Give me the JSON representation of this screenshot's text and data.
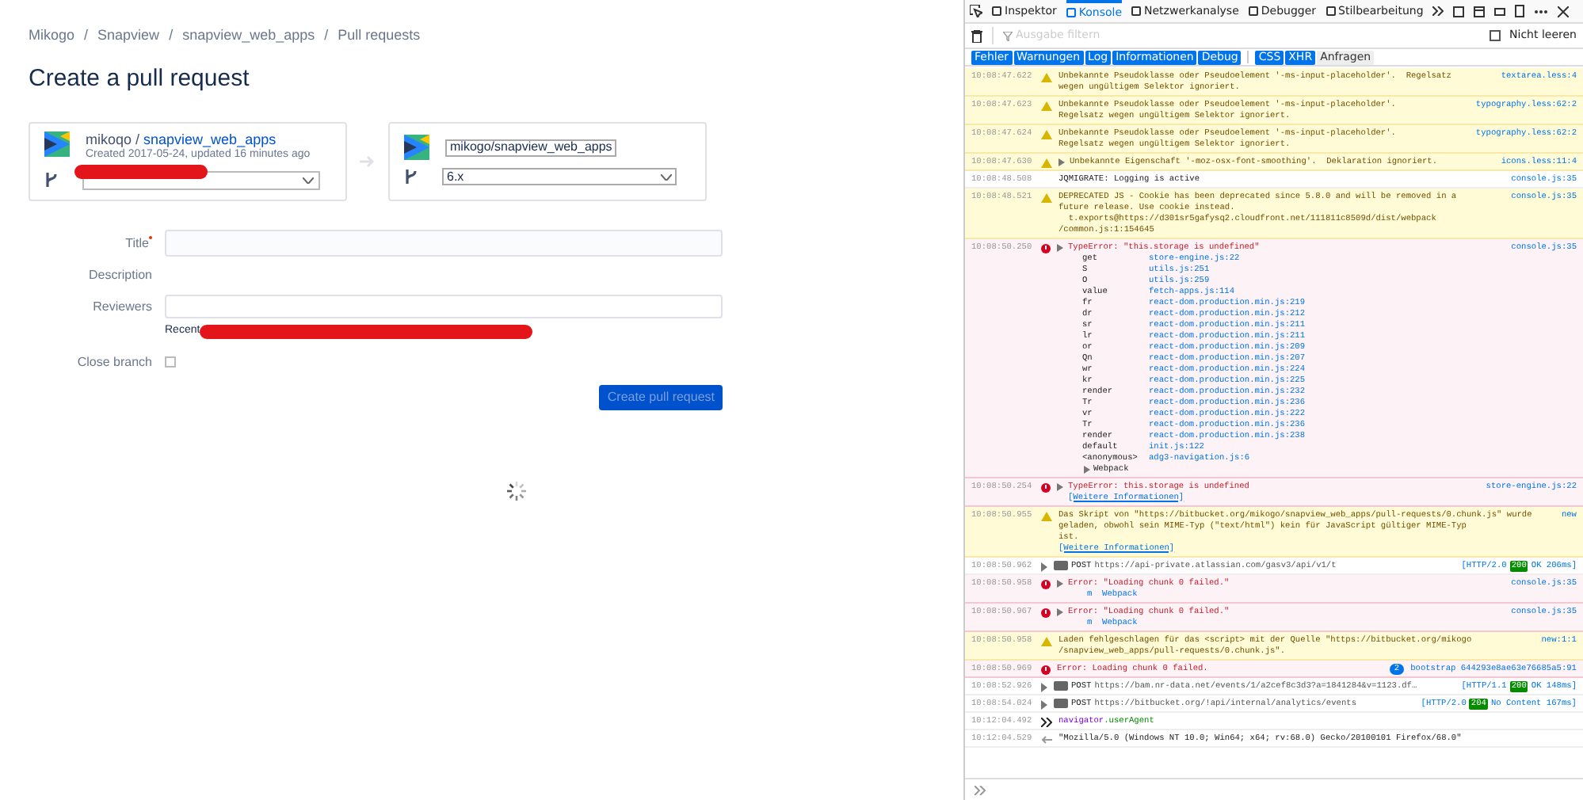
{
  "breadcrumbs": [
    "Mikogo",
    "Snapview",
    "snapview_web_apps",
    "Pull requests"
  ],
  "breadcrumb_separators": [
    "/",
    "/",
    "/"
  ],
  "page_title": "Create a pull request",
  "source": {
    "owner": "mikoqo /",
    "repo": "snapview_web_apps",
    "meta": "Created 2017-05-24, updated 16 minutes ago"
  },
  "destination": {
    "repo_select": "mikogo/snapview_web_apps",
    "branch_select": "6.x"
  },
  "form": {
    "title_label": "Title",
    "description_label": "Description",
    "reviewers_label": "Reviewers",
    "recent_label": "Recent",
    "close_branch_label": "Close branch",
    "close_branch_checked": false,
    "submit": "Create pull request",
    "submit_disabled": true
  },
  "devtools": {
    "tabs": [
      {
        "label": "Inspektor",
        "selected": false
      },
      {
        "label": "Konsole",
        "selected": true
      },
      {
        "label": "Netzwerkanalyse",
        "selected": false
      },
      {
        "label": "Debugger",
        "selected": false
      },
      {
        "label": "Stilbearbeitung",
        "selected": false
      }
    ],
    "filter_placeholder": "Ausgabe filtern",
    "persist_label": "Nicht leeren",
    "persist_checked": false,
    "filters": [
      {
        "label": "Fehler",
        "selected": true
      },
      {
        "label": "Warnungen",
        "selected": true
      },
      {
        "label": "Log",
        "selected": true
      },
      {
        "label": "Informationen",
        "selected": true
      },
      {
        "label": "Debug",
        "selected": true
      },
      {
        "label": "CSS",
        "selected": true
      },
      {
        "label": "XHR",
        "selected": true
      },
      {
        "label": "Anfragen",
        "selected": false
      }
    ],
    "entries": [
      {
        "kind": "warn",
        "time": "10:08:47.622",
        "lines": [
          "Unbekannte Pseudoklasse oder Pseudoelement '-ms-input-placeholder'.  Regelsatz",
          "wegen ungültigem Selektor ignoriert."
        ],
        "source": "textarea.less:4"
      },
      {
        "kind": "warn",
        "time": "10:08:47.623",
        "lines": [
          "Unbekannte Pseudoklasse oder Pseudoelement '-ms-input-placeholder'.",
          "Regelsatz wegen ungültigem Selektor ignoriert."
        ],
        "source": "typography.less:62:2"
      },
      {
        "kind": "warn",
        "time": "10:08:47.624",
        "lines": [
          "Unbekannte Pseudoklasse oder Pseudoelement '-ms-input-placeholder'.",
          "Regelsatz wegen ungültigem Selektor ignoriert."
        ],
        "source": "typography.less:62:2"
      },
      {
        "kind": "warn",
        "time": "10:08:47.630",
        "expandable": true,
        "lines": [
          "Unbekannte Eigenschaft '-moz-osx-font-smoothing'.  Deklaration ignoriert."
        ],
        "source": "icons.less:11:4"
      },
      {
        "kind": "log",
        "time": "10:08:48.508",
        "lines": [
          "JQMIGRATE: Logging is active"
        ],
        "source": "console.js:35"
      },
      {
        "kind": "warn",
        "time": "10:08:48.521",
        "lines": [
          "DEPRECATED JS - Cookie has been deprecated since 5.8.0 and will be removed in a",
          "future release. Use cookie instead.",
          "  t.exports@https://d301sr5gafysq2.cloudfront.net/111811c8509d/dist/webpack",
          "/common.js:1:154645"
        ],
        "source": "console.js:35"
      },
      {
        "kind": "error",
        "time": "10:08:50.250",
        "expandable": true,
        "lines": [
          "TypeError: \"this.storage is undefined\""
        ],
        "source": "console.js:35",
        "stack": [
          {
            "fn": "get",
            "loc": "store-engine.js:22"
          },
          {
            "fn": "S",
            "loc": "utils.js:251"
          },
          {
            "fn": "O",
            "loc": "utils.js:259"
          },
          {
            "fn": "value",
            "loc": "fetch-apps.js:114"
          },
          {
            "fn": "fr",
            "loc": "react-dom.production.min.js:219"
          },
          {
            "fn": "dr",
            "loc": "react-dom.production.min.js:212"
          },
          {
            "fn": "sr",
            "loc": "react-dom.production.min.js:211"
          },
          {
            "fn": "lr",
            "loc": "react-dom.production.min.js:211"
          },
          {
            "fn": "or",
            "loc": "react-dom.production.min.js:209"
          },
          {
            "fn": "Qn",
            "loc": "react-dom.production.min.js:207"
          },
          {
            "fn": "wr",
            "loc": "react-dom.production.min.js:224"
          },
          {
            "fn": "kr",
            "loc": "react-dom.production.min.js:225"
          },
          {
            "fn": "render",
            "loc": "react-dom.production.min.js:232"
          },
          {
            "fn": "Tr",
            "loc": "react-dom.production.min.js:236"
          },
          {
            "fn": "vr",
            "loc": "react-dom.production.min.js:222"
          },
          {
            "fn": "Tr",
            "loc": "react-dom.production.min.js:236"
          },
          {
            "fn": "render",
            "loc": "react-dom.production.min.js:238"
          },
          {
            "fn": "default",
            "loc": "init.js:122"
          },
          {
            "fn": "<anonymous>",
            "loc": "adg3-navigation.js:6"
          }
        ],
        "footer": "Webpack"
      },
      {
        "kind": "error",
        "time": "10:08:50.254",
        "expandable": true,
        "lines": [
          "TypeError: this.storage is undefined"
        ],
        "link": "[Weitere Informationen]",
        "source": "store-engine.js:22"
      },
      {
        "kind": "warn",
        "time": "10:08:50.955",
        "lines": [
          "Das Skript von \"https://bitbucket.org/mikogo/snapview_web_apps/pull-requests/0.chunk.js\" wurde",
          "geladen, obwohl sein MIME-Typ (\"text/html\") kein für JavaScript gültiger MIME-Typ",
          "ist."
        ],
        "link": "[Weitere Informationen]",
        "source": "new"
      },
      {
        "kind": "net",
        "time": "10:08:50.962",
        "method": "POST",
        "url": "https://api-private.atlassian.com/gasv3/api/v1/t",
        "protocol": "[HTTP/2.0",
        "status": "200",
        "status_text": "OK 206ms]"
      },
      {
        "kind": "error",
        "time": "10:08:50.958",
        "expandable": true,
        "lines": [
          "Error: \"Loading chunk 0 failed.\""
        ],
        "source": "console.js:35",
        "trace": "m  Webpack"
      },
      {
        "kind": "error",
        "time": "10:08:50.967",
        "expandable": true,
        "lines": [
          "Error: \"Loading chunk 0 failed.\""
        ],
        "source": "console.js:35",
        "trace": "m  Webpack"
      },
      {
        "kind": "warn",
        "time": "10:08:50.958",
        "lines": [
          "Laden fehlgeschlagen für das <script> mit der Quelle \"https://bitbucket.org/mikogo",
          "/snapview_web_apps/pull-requests/0.chunk.js\"."
        ],
        "source": "new:1:1"
      },
      {
        "kind": "error",
        "time": "10:08:50.969",
        "lines": [
          "Error: Loading chunk 0 failed."
        ],
        "count": "2",
        "source": "bootstrap 644293e8ae63e76685a5:91"
      },
      {
        "kind": "net",
        "time": "10:08:52.926",
        "method": "POST",
        "url": "https://bam.nr-data.net/events/1/a2cef8c3d3?a=1841284&v=1123.df…",
        "protocol": "[HTTP/1.1",
        "status": "200",
        "status_text": "OK 148ms]"
      },
      {
        "kind": "net",
        "time": "10:08:54.024",
        "method": "POST",
        "url": "https://bitbucket.org/!api/internal/analytics/events",
        "protocol": "[HTTP/2.0",
        "status": "204",
        "status_text": "No Content 167ms]"
      },
      {
        "kind": "input",
        "time": "10:12:04.492",
        "object": "navigator",
        "property": ".userAgent"
      },
      {
        "kind": "output",
        "time": "10:12:04.529",
        "lines": [
          "\"Mozilla/5.0 (Windows NT 10.0; Win64; x64; rv:68.0) Gecko/20100101 Firefox/68.0\""
        ]
      }
    ]
  }
}
